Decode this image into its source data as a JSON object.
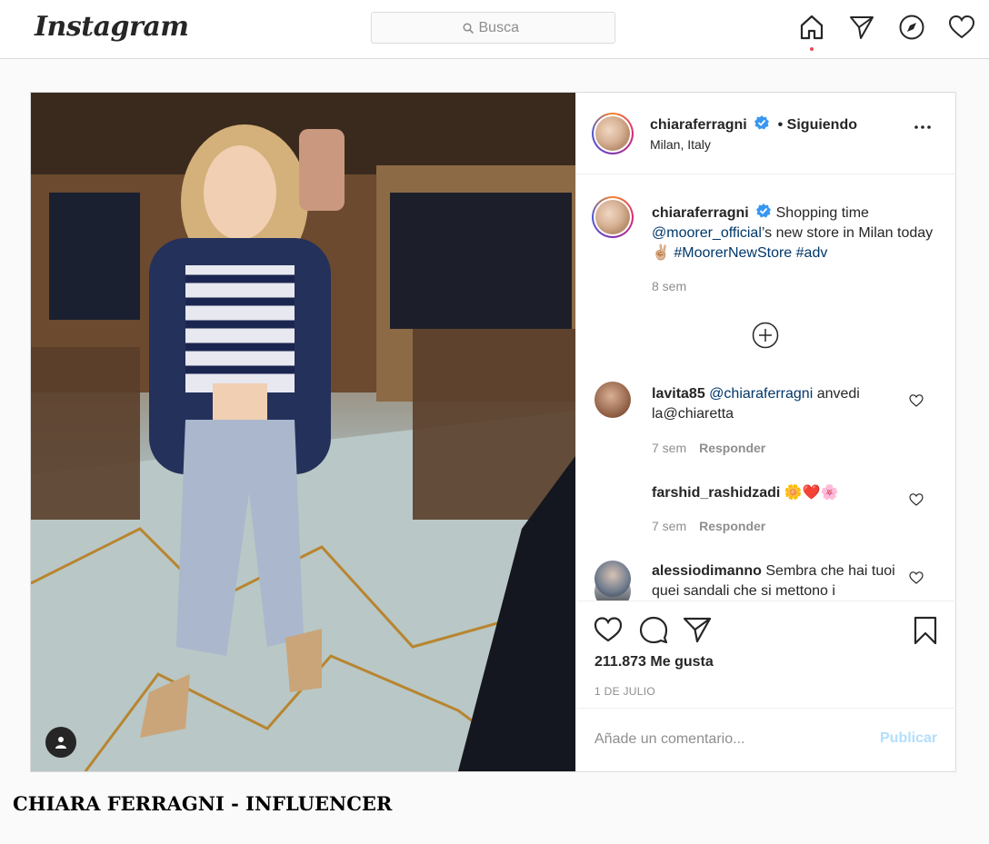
{
  "nav": {
    "logo": "Instagram",
    "search_placeholder": "Busca",
    "icons": [
      "home-icon",
      "direct-icon",
      "explore-icon",
      "activity-icon"
    ],
    "notification_color": "#ed4956"
  },
  "post": {
    "author": {
      "username": "chiaraferragni",
      "verified": true,
      "follow_status": "• Siguiendo",
      "location": "Milan, Italy"
    },
    "caption": {
      "username": "chiaraferragni",
      "text_start": "Shopping time",
      "mention": "@moorer_official",
      "text_mid": "’s new store in Milan today ✌🏼",
      "hashtag1": "#MoorerNewStore",
      "hashtag2": "#adv",
      "time": "8 sem"
    },
    "load_more_icon": "plus-circle-icon",
    "comments": [
      {
        "username": "lavita85",
        "mention": "@chiaraferragni",
        "text": "anvedi la@chiaretta",
        "time": "7 sem",
        "reply": "Responder"
      },
      {
        "username": "farshid_rashidzadi",
        "text": "🌼❤️🌸",
        "time": "7 sem",
        "reply": "Responder"
      },
      {
        "username": "alessiodimanno",
        "text": "Sembra che hai tuoi quei sandali che si mettono i",
        "time": "",
        "reply": ""
      }
    ],
    "likes": "211.873 Me gusta",
    "date": "1 DE JULIO",
    "add_comment_placeholder": "Añade un comentario...",
    "publish_label": "Publicar",
    "publish_color": "#b2dffc",
    "link_color": "#00376b",
    "verified_color": "#3897f0"
  },
  "banner": {
    "title": "CHIARA FERRAGNI - INFLUENCER"
  }
}
